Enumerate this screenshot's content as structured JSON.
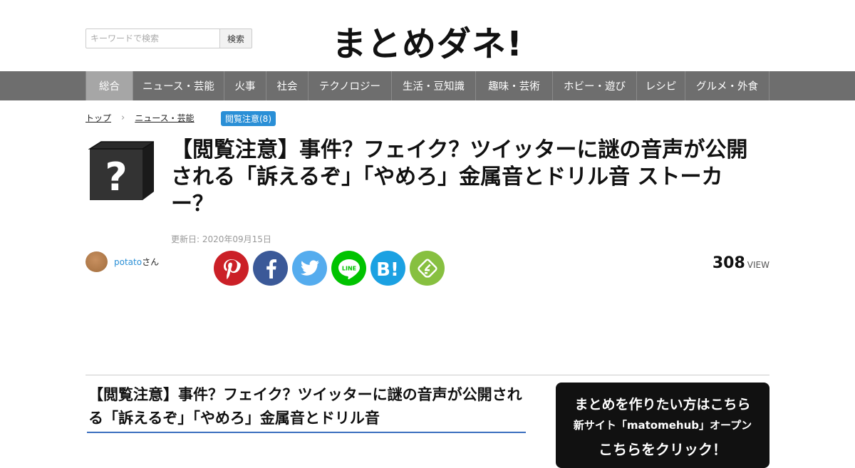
{
  "header": {
    "search_placeholder": "キーワードで検索",
    "search_button": "検索",
    "logo": "まとめダネ!"
  },
  "nav": {
    "items": [
      {
        "label": "総合",
        "active": true
      },
      {
        "label": "ニュース・芸能"
      },
      {
        "label": "火事"
      },
      {
        "label": "社会"
      },
      {
        "label": "テクノロジー"
      },
      {
        "label": "生活・豆知識"
      },
      {
        "label": "趣味・芸術"
      },
      {
        "label": "ホビー・遊び"
      },
      {
        "label": "レシピ"
      },
      {
        "label": "グルメ・外食"
      }
    ]
  },
  "breadcrumb": {
    "home": "トップ",
    "category": "ニュース・芸能"
  },
  "tag": "閲覧注意(8)",
  "article": {
    "title": "【閲覧注意】事件？フェイク？ツイッターに謎の音声が公開される「訴えるぞ」「やめろ」金属音とドリル音 ストーカー？",
    "updated": "更新日: 2020年09月15日",
    "author_name": "potato",
    "author_suffix": "さん",
    "view_count": "308",
    "view_label": "VIEW"
  },
  "share": {
    "pinterest_color": "#cb2027",
    "facebook_color": "#3b5998",
    "twitter_color": "#55acee",
    "line_color": "#00c300",
    "hatena_color": "#1ba1e2",
    "feedly_color": "#87c040"
  },
  "section_heading": "【閲覧注意】事件？フェイク？ツイッターに謎の音声が公開される「訴えるぞ」「やめろ」金属音とドリル音",
  "promo": {
    "line1": "まとめを作りたい方はこちら",
    "line2": "新サイト「matomehub」オープン",
    "line3": "こちらをクリック！"
  }
}
